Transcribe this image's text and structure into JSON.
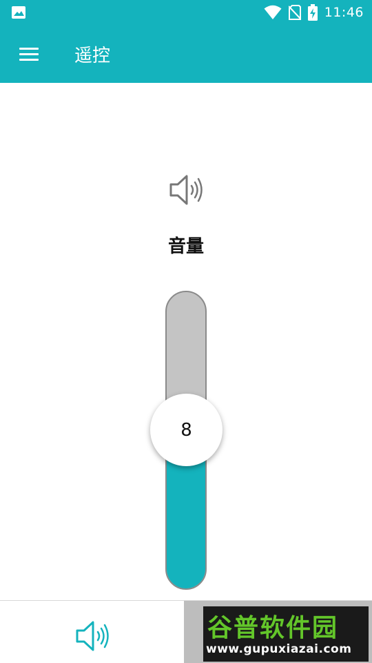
{
  "status_bar": {
    "time": "11:46",
    "left_icon": "image-icon",
    "icons": [
      "wifi-icon",
      "no-sim-icon",
      "battery-charging-icon"
    ]
  },
  "app_bar": {
    "menu_icon": "hamburger-menu-icon",
    "title": "遥控"
  },
  "main": {
    "icon": "speaker-volume-icon",
    "label": "音量",
    "slider": {
      "value": "8",
      "fill_fraction": 0.44,
      "track_color": "#c4c4c4",
      "fill_color": "#14b3bd"
    }
  },
  "bottom_nav": {
    "tabs": [
      {
        "icon": "speaker-volume-icon",
        "active": true
      }
    ]
  },
  "watermark": {
    "text": "谷普软件园",
    "url": "www.gupuxiazai.com"
  },
  "colors": {
    "accent": "#14b3bd",
    "background": "#ffffff",
    "text": "#111111"
  }
}
